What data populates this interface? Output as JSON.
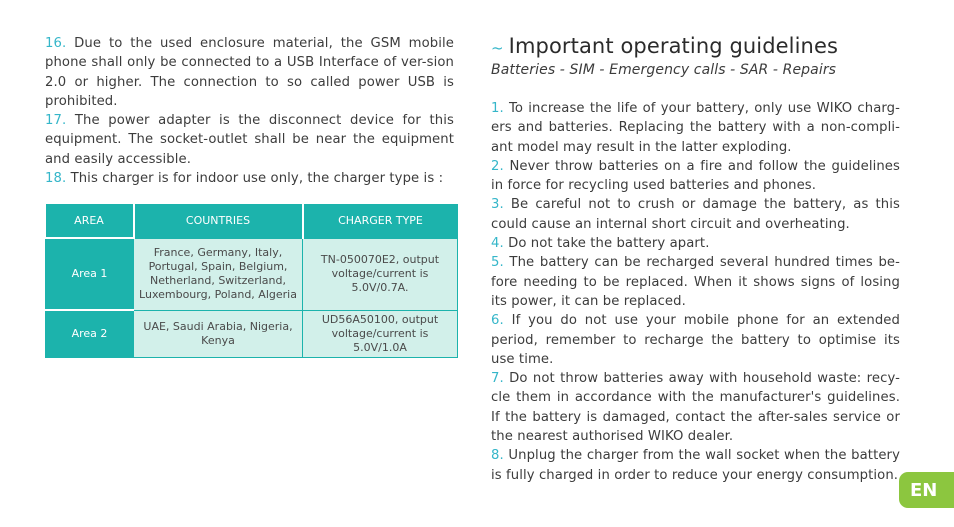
{
  "left_column": {
    "items": [
      {
        "num": "16.",
        "text": " Due to the used enclosure material, the GSM mobile phone shall only be connected to a USB Interface of ver-sion 2.0 or higher. The connection to so called power USB is prohibited."
      },
      {
        "num": "17.",
        "text": " The power adapter is the disconnect device for this equipment. The socket-outlet shall be near the equipment and easily accessible."
      },
      {
        "num": "18.",
        "text": " This charger is for indoor use only, the charger type is :"
      }
    ]
  },
  "charger_table": {
    "headers": [
      "AREA",
      "COUNTRIES",
      "CHARGER TYPE"
    ],
    "rows": [
      {
        "area": "Area 1",
        "countries": "France, Germany, Italy, Portugal, Spain, Belgium, Netherland, Switzerland, Luxembourg, Poland, Algeria",
        "charger": "TN-050070E2, output voltage/current is 5.0V/0.7A."
      },
      {
        "area": "Area 2",
        "countries": "UAE, Saudi Arabia, Nigeria, Kenya",
        "charger": "UD56A50100, output voltage/current is 5.0V/1.0A"
      }
    ]
  },
  "right_column": {
    "tilde": "~",
    "title": "Important operating guidelines",
    "subtitle": "Batteries - SIM - Emergency calls - SAR - Repairs",
    "items": [
      {
        "num": "1.",
        "text": " To increase the life of your battery, only use WIKO charg-ers and batteries. Replacing the battery with a non-compli-ant model may result in the latter exploding."
      },
      {
        "num": "2.",
        "text": " Never throw batteries on a fire and follow the guidelines in force for recycling used batteries and phones."
      },
      {
        "num": "3.",
        "text": " Be careful not to crush or damage the battery, as this could cause an internal short circuit and overheating."
      },
      {
        "num": "4.",
        "text": " Do not take the battery apart."
      },
      {
        "num": "5.",
        "text": " The battery can be recharged several hundred times be-fore needing to be replaced. When it shows signs of losing its power, it can be replaced."
      },
      {
        "num": "6.",
        "text": " If you do not use your mobile phone for an extended period, remember to recharge the battery to optimise its use time."
      },
      {
        "num": "7.",
        "text": " Do not throw batteries away with household waste: recy-cle them in accordance with the manufacturer's guidelines. If the battery is damaged, contact the after-sales service or the nearest authorised WIKO dealer."
      },
      {
        "num": "8.",
        "text": " Unplug the charger from the wall socket when the battery is fully charged in order to reduce your energy consumption."
      }
    ]
  },
  "language_badge": "EN",
  "colors": {
    "accent": "#35b6c9",
    "table_header": "#1cb3ac",
    "table_cell": "#d2f0ea",
    "badge": "#8cc63f"
  }
}
